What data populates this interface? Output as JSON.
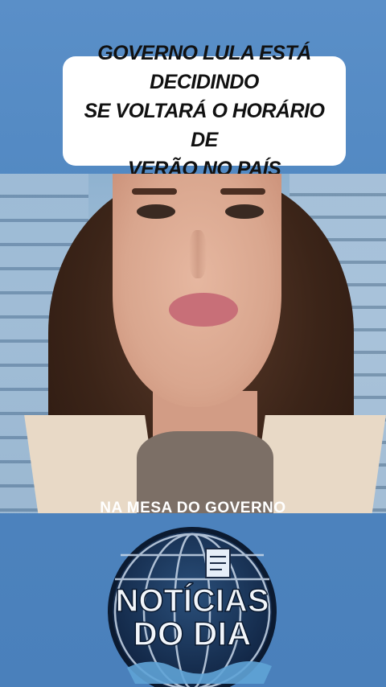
{
  "headline": {
    "line1": "GOVERNO LULA ESTÁ DECIDINDO",
    "line2": "SE VOLTARÁ O HORÁRIO DE",
    "line3": "VERÃO NO PAÍS"
  },
  "video": {
    "caption": "NA MESA DO GOVERNO"
  },
  "logo": {
    "line1": "NOTÍCIAS",
    "line2": "DO DIA"
  },
  "colors": {
    "background": "#5a8fc8",
    "logo_ring": "#1a2a44",
    "logo_text": "#f2f6fb"
  }
}
